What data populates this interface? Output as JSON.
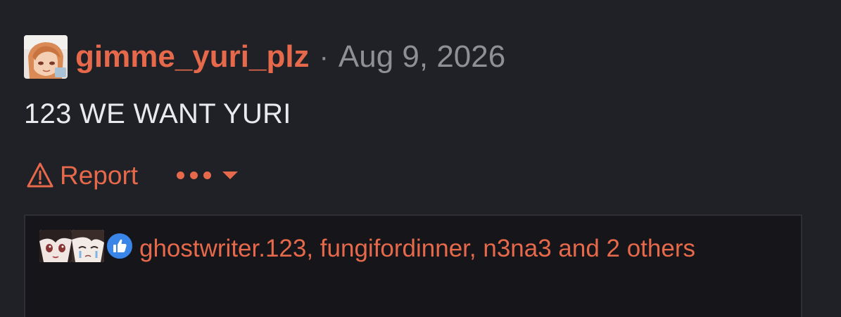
{
  "post": {
    "author": "gimme_yuri_plz",
    "separator": "·",
    "date": "Aug 9, 2026",
    "message": "123 WE WANT YURI"
  },
  "actions": {
    "report_label": "Report",
    "report_icon": "warning-triangle-icon",
    "more_icon": "ellipsis-dropdown-icon"
  },
  "reactions": {
    "icon": "thumbs-up-icon",
    "text": "ghostwriter.123, fungifordinner, n3na3 and 2 others"
  },
  "colors": {
    "background": "#202127",
    "accent": "#e5694a",
    "muted": "#8e9096",
    "text": "#e8eaed",
    "reactions_bg": "#15151a",
    "like_blue": "#3a86e8"
  }
}
